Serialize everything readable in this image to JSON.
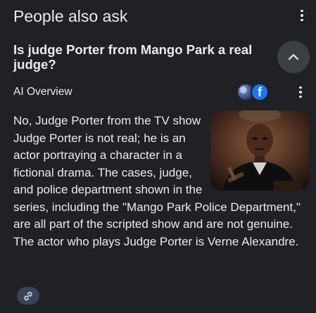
{
  "header": {
    "title": "People also ask",
    "more_icon": "kebab-vertical-icon"
  },
  "question": {
    "text": "Is judge Porter from Mango Park a real judge?",
    "toggle_icon": "chevron-up-icon"
  },
  "overview": {
    "label": "AI Overview",
    "source_icons": [
      "globe-icon",
      "facebook-icon"
    ],
    "facebook_glyph": "f",
    "more_icon": "kebab-vertical-icon",
    "image_icon": "judge-photo-icon",
    "answer": "No, Judge Porter from the TV show Judge Porter is not real; he is an actor portraying a character in a fictional drama. The cases, judge, and police department shown in the series, including the \"Mango Park Police Department,\" are all part of the scripted show and are not genuine. The actor who plays Judge Porter is Verne Alexandre."
  },
  "footer": {
    "link_icon": "link-icon"
  },
  "colors": {
    "background": "#202124",
    "text": "#e8eaed",
    "button_bg": "#3c4043",
    "link_chip_bg": "#394457",
    "facebook_blue": "#1877f2"
  }
}
